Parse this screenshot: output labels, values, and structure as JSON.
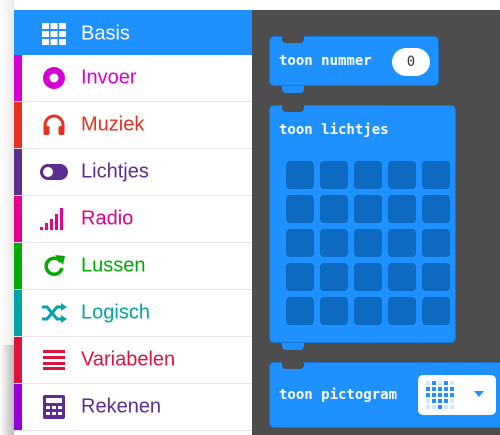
{
  "toolbox": {
    "categories": [
      {
        "label": "Basis",
        "color": "#1e90ff",
        "icon": "grid-icon",
        "selected": true
      },
      {
        "label": "Invoer",
        "color": "#d400d4",
        "icon": "circle-dot-icon"
      },
      {
        "label": "Muziek",
        "color": "#e63022",
        "icon": "headphones-icon"
      },
      {
        "label": "Lichtjes",
        "color": "#5c2d91",
        "icon": "toggle-icon"
      },
      {
        "label": "Radio",
        "color": "#e3008c",
        "icon": "signal-bars-icon"
      },
      {
        "label": "Lussen",
        "color": "#00aa00",
        "icon": "refresh-icon"
      },
      {
        "label": "Logisch",
        "color": "#00a4a6",
        "icon": "shuffle-icon"
      },
      {
        "label": "Variabelen",
        "color": "#dc143c",
        "icon": "list-icon"
      },
      {
        "label": "Rekenen",
        "color": "#9400d3",
        "icon": "calculator-icon"
      }
    ]
  },
  "workspace": {
    "blocks": {
      "show_number": {
        "label": "toon nummer",
        "value": "0"
      },
      "show_leds": {
        "label": "toon lichtjes"
      },
      "show_icon": {
        "label": "toon pictogram"
      }
    }
  },
  "colors": {
    "block": "#1e90ff",
    "workspace": "#4d4d4d",
    "led_off": "#0d6ac0"
  }
}
